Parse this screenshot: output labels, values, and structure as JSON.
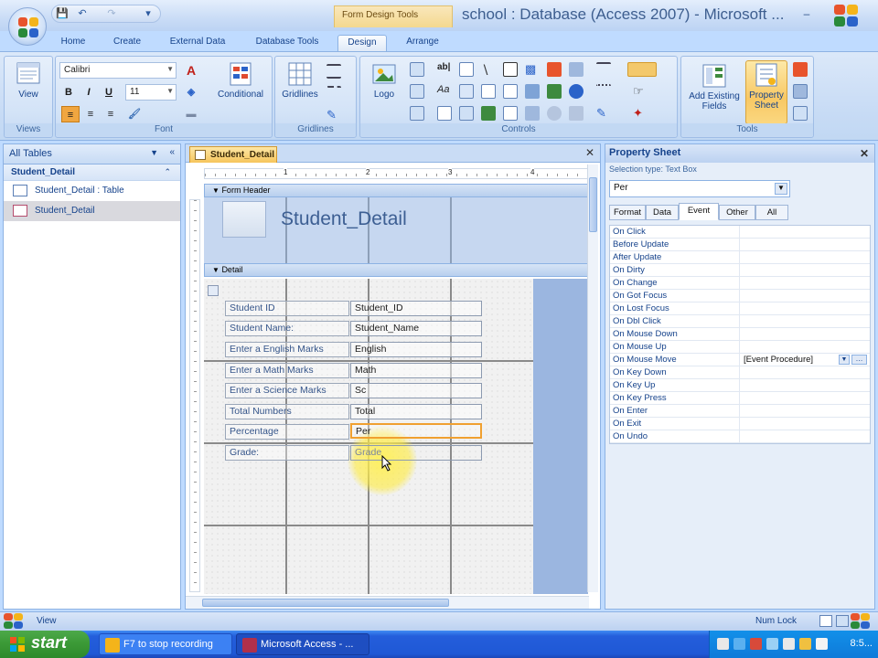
{
  "window": {
    "title": "school : Database (Access 2007) - Microsoft ...",
    "contextual_group": "Form Design Tools",
    "controls": [
      "–",
      "▭",
      "✕"
    ]
  },
  "ribbon": {
    "tabs": [
      "Home",
      "Create",
      "External Data",
      "Database Tools",
      "Design",
      "Arrange"
    ],
    "active_tab": "Design",
    "groups": {
      "views": {
        "label": "Views",
        "view_button": "View"
      },
      "font": {
        "label": "Font",
        "font_name": "Calibri",
        "font_size": "11",
        "bold": "B",
        "italic": "I",
        "underline": "U",
        "conditional": "Conditional"
      },
      "gridlines": {
        "label": "Gridlines",
        "gridlines_button": "Gridlines"
      },
      "controls": {
        "label": "Controls",
        "logo_button": "Logo"
      },
      "tools": {
        "label": "Tools",
        "add_existing_fields": "Add Existing Fields",
        "property_sheet": "Property Sheet"
      }
    }
  },
  "nav": {
    "header": "All Tables",
    "group": "Student_Detail",
    "items": [
      {
        "label": "Student_Detail : Table"
      },
      {
        "label": "Student_Detail"
      }
    ]
  },
  "document": {
    "tab": "Student_Detail",
    "ruler_numbers": [
      "1",
      "2",
      "3",
      "4"
    ],
    "form_header_label": "Form Header",
    "form_title": "Student_Detail",
    "detail_label": "Detail",
    "fields": [
      {
        "label": "Student ID",
        "control": "Student_ID"
      },
      {
        "label": "Student Name:",
        "control": "Student_Name"
      },
      {
        "label": "Enter a English Marks",
        "control": "English"
      },
      {
        "label": "Enter a Math Marks",
        "control": "Math"
      },
      {
        "label": "Enter a Science Marks",
        "control": "Sc"
      },
      {
        "label": "Total Numbers",
        "control": "Total"
      },
      {
        "label": "Percentage",
        "control": "Per"
      },
      {
        "label": "Grade:",
        "control": "Grade"
      }
    ]
  },
  "property_sheet": {
    "title": "Property Sheet",
    "selection_type": "Selection type: Text Box",
    "selected_control": "Per",
    "tabs": [
      "Format",
      "Data",
      "Event",
      "Other",
      "All"
    ],
    "active_tab": "Event",
    "rows": [
      {
        "name": "On Click",
        "value": ""
      },
      {
        "name": "Before Update",
        "value": ""
      },
      {
        "name": "After Update",
        "value": ""
      },
      {
        "name": "On Dirty",
        "value": ""
      },
      {
        "name": "On Change",
        "value": ""
      },
      {
        "name": "On Got Focus",
        "value": ""
      },
      {
        "name": "On Lost Focus",
        "value": ""
      },
      {
        "name": "On Dbl Click",
        "value": ""
      },
      {
        "name": "On Mouse Down",
        "value": ""
      },
      {
        "name": "On Mouse Up",
        "value": ""
      },
      {
        "name": "On Mouse Move",
        "value": "[Event Procedure]"
      },
      {
        "name": "On Key Down",
        "value": ""
      },
      {
        "name": "On Key Up",
        "value": ""
      },
      {
        "name": "On Key Press",
        "value": ""
      },
      {
        "name": "On Enter",
        "value": ""
      },
      {
        "name": "On Exit",
        "value": ""
      },
      {
        "name": "On Undo",
        "value": ""
      }
    ]
  },
  "status": {
    "left": "View",
    "right": "Num Lock"
  },
  "taskbar": {
    "start": "start",
    "buttons": [
      {
        "label": "F7 to stop recording"
      },
      {
        "label": "Microsoft Access - ..."
      }
    ],
    "time": "8:5..."
  }
}
